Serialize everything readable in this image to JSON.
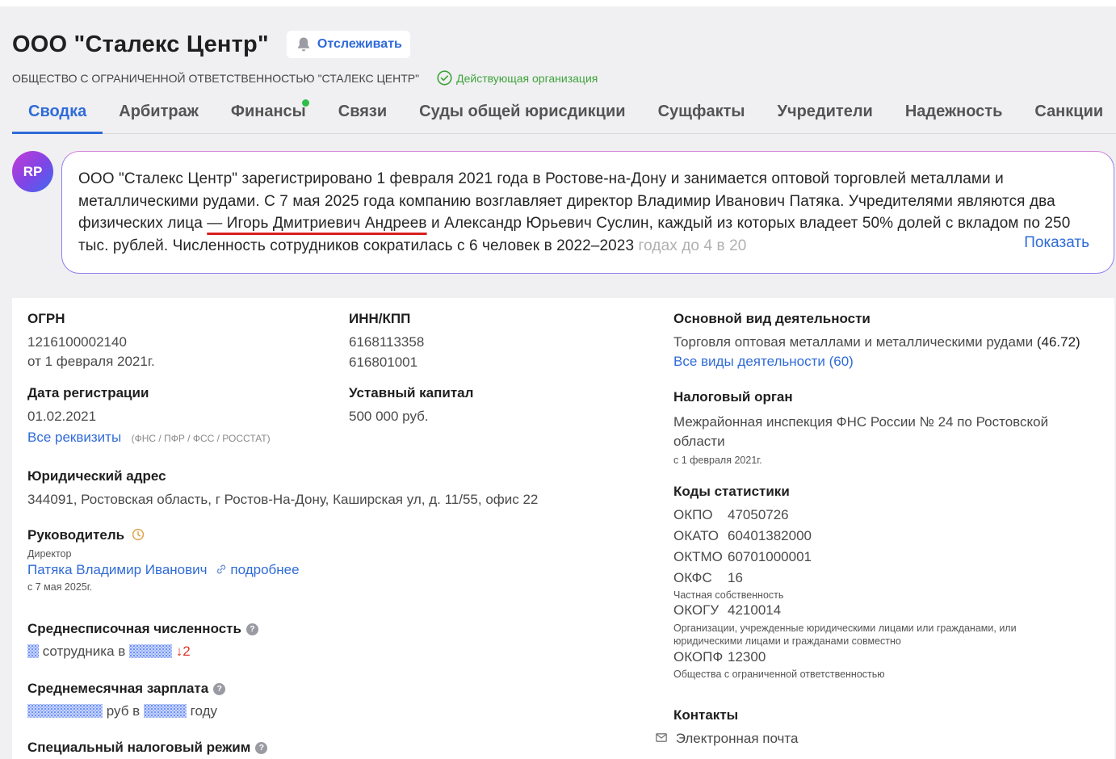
{
  "company": {
    "title": "ООО \"Сталекс Центр\"",
    "full_name": "ОБЩЕСТВО С ОГРАНИЧЕННОЙ ОТВЕТСТВЕННОСТЬЮ \"СТАЛЕКС ЦЕНТР\"",
    "status": "Действующая организация",
    "follow_label": "Отслеживать"
  },
  "tabs": [
    "Сводка",
    "Арбитраж",
    "Финансы",
    "Связи",
    "Суды общей юрисдикции",
    "Сущфакты",
    "Учредители",
    "Надежность",
    "Санкции"
  ],
  "summary": {
    "avatar": "RP",
    "text_1": "ООО \"Сталекс Центр\" зарегистрировано 1 февраля 2021 года в Ростове-на-Дону и занимается оптовой торговлей металлами и металлическими рудами. С 7 мая 2025 года компанию возглавляет директор Владимир Иванович Патяка. Учредителями являются два физических лица ",
    "text_underlined": "— Игорь Дмитриевич Андреев",
    "text_2": " и Александр Юрьевич Суслин, каждый из которых владеет 50% долей с вкладом по 250 тыс. рублей. Численность сотрудников сократилась с 6 человек в 2022–2023 ",
    "text_faded": "годах до 4 в 20",
    "show_more": "Показать"
  },
  "requisites": {
    "ogrn_label": "ОГРН",
    "ogrn": "1216100002140",
    "ogrn_date": "от 1 февраля 2021г.",
    "inn_label": "ИНН/КПП",
    "inn": "6168113358",
    "kpp": "616801001",
    "reg_date_label": "Дата регистрации",
    "reg_date": "01.02.2021",
    "capital_label": "Уставный капитал",
    "capital": "500 000 руб.",
    "all_requisites": "Все реквизиты",
    "requisites_note": "(ФНС / ПФР / ФСС / РОССТАТ)"
  },
  "address": {
    "label": "Юридический адрес",
    "value": "344091, Ростовская область, г Ростов-На-Дону, Каширская ул, д. 11/55, офис 22"
  },
  "director": {
    "label": "Руководитель",
    "role": "Директор",
    "name": "Патяка Владимир Иванович",
    "more": "подробнее",
    "since": "с 7 мая 2025г."
  },
  "headcount": {
    "label": "Среднесписочная численность",
    "text_a": "сотрудника в",
    "change": "↓2"
  },
  "salary": {
    "label": "Среднемесячная зарплата",
    "text_a": "руб в",
    "text_b": "году"
  },
  "tax_regime": {
    "label": "Специальный налоговый режим"
  },
  "activity": {
    "label": "Основной вид деятельности",
    "value": "Торговля оптовая металлами и металлическими рудами",
    "code": "(46.72)",
    "all_link": "Все виды деятельности (60)"
  },
  "tax_office": {
    "label": "Налоговый орган",
    "value": "Межрайонная инспекция ФНС России № 24 по Ростовской области",
    "since": "с 1 февраля 2021г."
  },
  "stat_codes": {
    "label": "Коды статистики",
    "okpo_k": "ОКПО",
    "okpo_v": "47050726",
    "okato_k": "ОКАТО",
    "okato_v": "60401382000",
    "oktmo_k": "ОКТМО",
    "oktmo_v": "60701000001",
    "okfs_k": "ОКФС",
    "okfs_v": "16",
    "okfs_desc": "Частная собственность",
    "okogu_k": "ОКОГУ",
    "okogu_v": "4210014",
    "okogu_desc": "Организации, учрежденные юридическими лицами или гражданами, или юридическими лицами и гражданами совместно",
    "okopf_k": "ОКОПФ",
    "okopf_v": "12300",
    "okopf_desc": "Общества с ограниченной ответственностью"
  },
  "contacts": {
    "label": "Контакты",
    "email": "Электронная почта"
  },
  "colors": {
    "accent": "#2f6bd8",
    "active_status": "#3fa33b",
    "decrease": "#e0342c",
    "underline": "#d81e1e"
  }
}
